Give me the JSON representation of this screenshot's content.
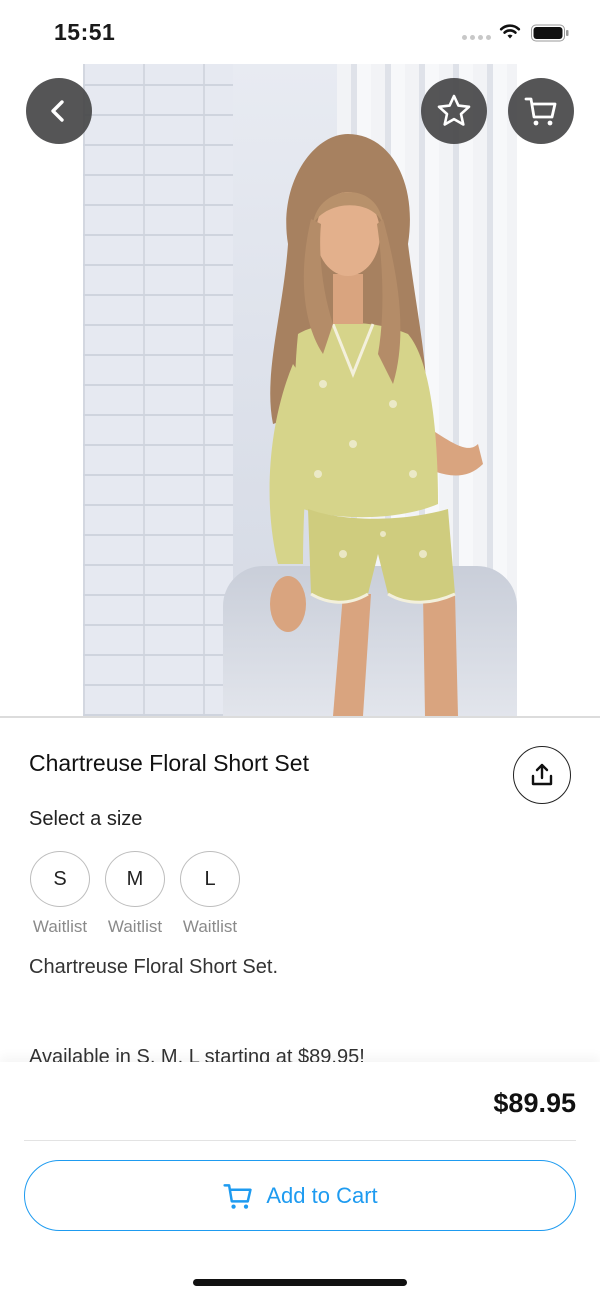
{
  "status_bar": {
    "time": "15:51"
  },
  "product": {
    "title": "Chartreuse Floral Short Set",
    "size_label": "Select a size",
    "sizes": [
      {
        "label": "S",
        "status": "Waitlist"
      },
      {
        "label": "M",
        "status": "Waitlist"
      },
      {
        "label": "L",
        "status": "Waitlist"
      }
    ],
    "description": "Chartreuse Floral Short Set.",
    "availability": "Available in S, M, L starting at $89.95!",
    "price": "$89.95",
    "image_count": 1,
    "active_image": 1
  },
  "actions": {
    "add_to_cart_label": "Add to Cart"
  },
  "icons": {
    "back": "chevron-left-icon",
    "favorite": "star-icon",
    "cart": "cart-icon",
    "share": "share-icon"
  },
  "colors": {
    "accent": "#1e9bf0",
    "overlay_button": "#464648",
    "outfit": "#d6d48a"
  }
}
